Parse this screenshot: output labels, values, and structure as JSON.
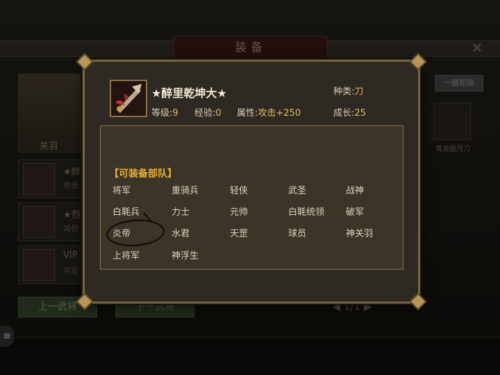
{
  "background": {
    "title": "装备",
    "hero_name": "关羽",
    "slots": [
      {
        "title": "★醉",
        "sub": "攻击"
      },
      {
        "title": "★烈",
        "sub": "减伤"
      },
      {
        "title": "VIP",
        "sub": "不可"
      }
    ],
    "prev_button": "上一武将",
    "next_button": "下一武将",
    "pager": "1/1",
    "right_button": "一键卸装",
    "right_label": "青龙偃月刀"
  },
  "dialog": {
    "item_name": "★醉里乾坤大★",
    "type_label": "种类:",
    "type_value": "刀",
    "level_label": "等级:",
    "level_value": "9",
    "exp_label": "经验:",
    "exp_value": "0",
    "attr_label": "属性:",
    "attr_value": "攻击+250",
    "growth_label": "成长:",
    "growth_value": "25",
    "section_title": "【可装备部队】",
    "units": [
      "将军",
      "重骑兵",
      "轻侠",
      "武圣",
      "战神",
      "白毦兵",
      "力士",
      "元帅",
      "白毦统领",
      "破军",
      "炎帝",
      "水君",
      "天罡",
      "球员",
      "神关羽",
      "上将军",
      "神浮生"
    ]
  },
  "colors": {
    "gold_value": "#e6b660",
    "section_title": "#e6b038",
    "border": "#8c7650"
  },
  "icons": {
    "item": "weapon-blade-icon",
    "close": "close-icon",
    "annotation": "hand-drawn-circle"
  }
}
